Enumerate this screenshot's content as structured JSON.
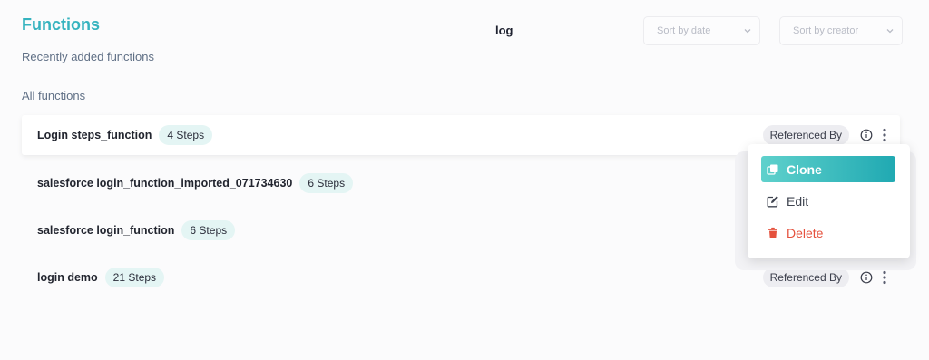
{
  "header": {
    "title": "Functions",
    "search_value": "log",
    "sort_by_date": "Sort by date",
    "sort_by_creator": "Sort by creator"
  },
  "sections": {
    "recent": "Recently added functions",
    "all": "All functions"
  },
  "functions": [
    {
      "name": "Login steps_function",
      "steps": "4 Steps",
      "referenced_by": "Referenced By"
    },
    {
      "name": "salesforce login_function_imported_071734630",
      "steps": "6 Steps"
    },
    {
      "name": "salesforce login_function",
      "steps": "6 Steps"
    },
    {
      "name": "login demo",
      "steps": "21 Steps",
      "referenced_by": "Referenced By"
    }
  ],
  "context_menu": {
    "clone": "Clone",
    "edit": "Edit",
    "delete": "Delete"
  },
  "colors": {
    "accent": "#35b3bf",
    "clone_gradient_start": "#5fd1cc",
    "clone_gradient_end": "#20a9b2",
    "delete": "#e5513d",
    "steps_badge_bg": "#e4f5f4"
  },
  "icons": {
    "info": "info-circle-icon",
    "more": "kebab-vertical-icon",
    "chevron": "chevron-down-icon",
    "clone": "copy-icon",
    "edit": "pencil-square-icon",
    "delete": "trash-icon"
  }
}
